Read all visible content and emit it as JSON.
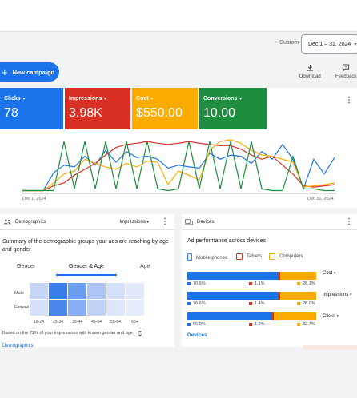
{
  "header": {
    "date_label": "Custom",
    "date_range": "Dec 1 – 31, 2024",
    "date_caret": "▾"
  },
  "actions": {
    "new_campaign": "New campaign",
    "new_campaign_icon": "+",
    "download_label": "Download",
    "feedback_label": "Feedback"
  },
  "scorecards": [
    {
      "label": "Clicks",
      "value": "78",
      "color": "#1a73e8"
    },
    {
      "label": "Impressions",
      "value": "3.98K",
      "color": "#d93025"
    },
    {
      "label": "Cost",
      "value": "$550.00",
      "color": "#f9ab00"
    },
    {
      "label": "Conversions",
      "value": "10.00",
      "color": "#1e8e3e"
    }
  ],
  "caret": "▾",
  "more_icon": "⋮",
  "chart_data": {
    "type": "line",
    "x_start": "Dec 1, 2024",
    "x_end": "Dec 31, 2024",
    "x": [
      1,
      2,
      3,
      4,
      5,
      6,
      7,
      8,
      9,
      10,
      11,
      12,
      13,
      14,
      15,
      16,
      17,
      18,
      19,
      20,
      21,
      22,
      23,
      24,
      25,
      26,
      27,
      28,
      29,
      30,
      31
    ],
    "series": [
      {
        "name": "Clicks",
        "color": "#1a73e8",
        "values": [
          0.02,
          0.02,
          0.02,
          0.32,
          0.45,
          0.42,
          0.6,
          0.45,
          0.7,
          0.5,
          0.68,
          0.58,
          0.6,
          0.55,
          0.4,
          0.45,
          0.42,
          0.4,
          0.65,
          0.55,
          0.62,
          0.6,
          0.48,
          0.68,
          0.55,
          0.8,
          0.55,
          0.05,
          0.55,
          0.3,
          0.58
        ]
      },
      {
        "name": "Impressions",
        "color": "#d93025",
        "values": [
          0.02,
          0.02,
          0.02,
          0.1,
          0.15,
          0.28,
          0.38,
          0.48,
          0.62,
          0.75,
          0.8,
          0.82,
          0.85,
          0.82,
          0.8,
          0.82,
          0.85,
          0.82,
          0.8,
          0.78,
          0.78,
          0.72,
          0.62,
          0.55,
          0.6,
          0.45,
          0.3,
          0.1,
          0.08,
          0.1,
          0.12
        ]
      },
      {
        "name": "Cost",
        "color": "#f9ab00",
        "values": [
          0.02,
          0.02,
          0.02,
          0.15,
          0.3,
          0.35,
          0.55,
          0.48,
          0.42,
          0.38,
          0.48,
          0.42,
          0.52,
          0.5,
          0.12,
          0.35,
          0.28,
          0.2,
          0.7,
          0.85,
          0.88,
          0.82,
          0.7,
          0.62,
          0.6,
          0.55,
          0.5,
          0.08,
          0.1,
          0.12,
          0.15
        ]
      },
      {
        "name": "Conversions",
        "color": "#1e8e3e",
        "values": [
          0.02,
          0.02,
          0.02,
          0.02,
          0.85,
          0.05,
          0.85,
          0.05,
          0.85,
          0.05,
          0.85,
          0.05,
          0.85,
          0.05,
          0.02,
          0.05,
          0.85,
          0.05,
          0.85,
          0.05,
          0.85,
          0.05,
          0.85,
          0.05,
          0.02,
          0.02,
          0.6,
          0.05,
          0.05,
          0.02,
          0.02
        ]
      }
    ]
  },
  "demographics": {
    "title": "Demographics",
    "metric": "Impressions",
    "summary": "Summary of the demographic groups your ads are reaching by age and gender",
    "tabs": [
      "Gender",
      "Gender & Age",
      "Age"
    ],
    "rows": [
      "Male",
      "Female"
    ],
    "ages": [
      "18-24",
      "25-34",
      "35-44",
      "45-54",
      "55-64",
      "65+"
    ],
    "heatmap": [
      [
        "#c6d5f7",
        "#3b7de8",
        "#6a9cf0",
        "#aec4f5",
        "#d5e0fa",
        "#e2e9fb"
      ],
      [
        "#d5e0fa",
        "#4a87ea",
        "#88adf2",
        "#c1d2f7",
        "#dde6fb",
        "#e6ecfc"
      ]
    ],
    "footnote": "Based on the 72% of your impressions with known gender and age.",
    "help_icon": "?",
    "link": "Demographics"
  },
  "devices": {
    "title": "Devices",
    "subtitle": "Ad performance across devices",
    "legend": [
      {
        "label": "Mobile phones",
        "color": "#1a73e8"
      },
      {
        "label": "Tablets",
        "color": "#d93025"
      },
      {
        "label": "Computers",
        "color": "#f9ab00"
      }
    ],
    "bars": [
      {
        "metric": "Cost",
        "mobile": "70.9%",
        "tablet": "1.1%",
        "computer": "28.1%",
        "m": 70.9,
        "t": 1.1,
        "c": 28.1
      },
      {
        "metric": "Impressions",
        "mobile": "70.6%",
        "tablet": "1.4%",
        "computer": "28.0%",
        "m": 70.6,
        "t": 1.4,
        "c": 28.0
      },
      {
        "metric": "Clicks",
        "mobile": "66.0%",
        "tablet": "1.2%",
        "computer": "32.7%",
        "m": 66.0,
        "t": 1.2,
        "c": 32.7
      }
    ],
    "link": "Devices"
  }
}
